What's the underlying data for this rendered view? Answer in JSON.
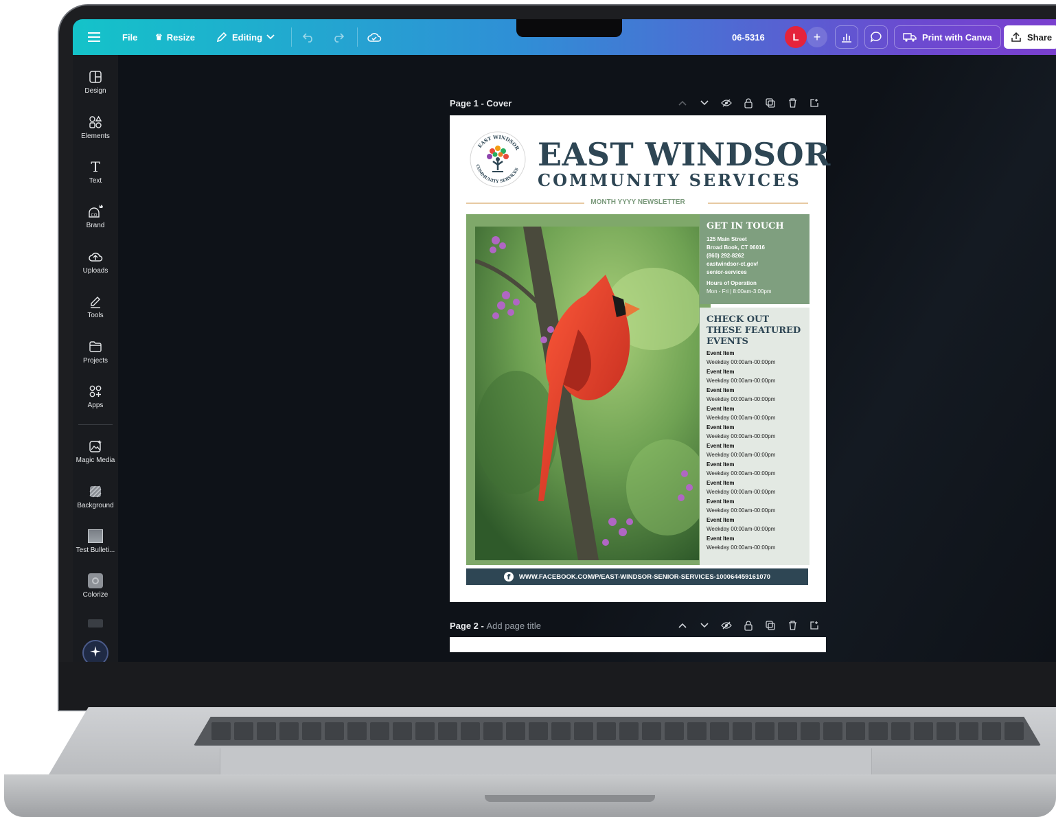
{
  "topbar": {
    "menu_icon": "hamburger-icon",
    "file_label": "File",
    "resize_label": "Resize",
    "editing_label": "Editing",
    "design_code": "06-5316",
    "avatar_initial": "L",
    "print_label": "Print with Canva",
    "share_label": "Share"
  },
  "sidebar": {
    "items": [
      {
        "label": "Design",
        "icon": "design-icon"
      },
      {
        "label": "Elements",
        "icon": "elements-icon"
      },
      {
        "label": "Text",
        "icon": "text-icon"
      },
      {
        "label": "Brand",
        "icon": "brand-icon"
      },
      {
        "label": "Uploads",
        "icon": "uploads-icon"
      },
      {
        "label": "Tools",
        "icon": "tools-icon"
      },
      {
        "label": "Projects",
        "icon": "projects-icon"
      },
      {
        "label": "Apps",
        "icon": "apps-icon"
      },
      {
        "label": "Magic Media",
        "icon": "magic-media-icon"
      },
      {
        "label": "Background",
        "icon": "background-icon"
      },
      {
        "label": "Test Bulleti...",
        "icon": "test-bulletin-thumbnail"
      },
      {
        "label": "Colorize",
        "icon": "colorize-icon"
      }
    ]
  },
  "pages": {
    "page1_prefix": "Page 1",
    "page1_title": "Cover",
    "page2_prefix": "Page 2",
    "page2_title_placeholder": "Add page title"
  },
  "newsletter": {
    "logo_top": "EAST WINDSOR",
    "logo_bottom": "COMMUNITY SERVICES",
    "title_line1": "EAST WINDSOR",
    "title_line2": "COMMUNITY SERVICES",
    "month_line": "MONTH YYYY NEWSLETTER",
    "contact": {
      "heading": "GET IN TOUCH",
      "address1": "125 Main Street",
      "address2": "Broad Book, CT 06016",
      "phone": "(860) 292-8262",
      "web1": "eastwindsor-ct.gov/",
      "web2": "senior-services",
      "hours_label": "Hours of Operation",
      "hours_value": "Mon - Fri | 8:00am-3:00pm"
    },
    "events": {
      "heading": "CHECK OUT THESE FEATURED EVENTS",
      "items": [
        {
          "name": "Event Item",
          "time": "Weekday 00:00am-00:00pm"
        },
        {
          "name": "Event Item",
          "time": "Weekday 00:00am-00:00pm"
        },
        {
          "name": "Event Item",
          "time": "Weekday 00:00am-00:00pm"
        },
        {
          "name": "Event Item",
          "time": "Weekday 00:00am-00:00pm"
        },
        {
          "name": "Event Item",
          "time": "Weekday 00:00am-00:00pm"
        },
        {
          "name": "Event Item",
          "time": "Weekday 00:00am-00:00pm"
        },
        {
          "name": "Event Item",
          "time": "Weekday 00:00am-00:00pm"
        },
        {
          "name": "Event Item",
          "time": "Weekday 00:00am-00:00pm"
        },
        {
          "name": "Event Item",
          "time": "Weekday 00:00am-00:00pm"
        },
        {
          "name": "Event Item",
          "time": "Weekday 00:00am-00:00pm"
        },
        {
          "name": "Event Item",
          "time": "Weekday 00:00am-00:00pm"
        }
      ]
    },
    "facebook_url": "WWW.FACEBOOK.COM/P/EAST-WINDSOR-SENIOR-SERVICES-100064459161070"
  },
  "colors": {
    "brand_teal": "#14c3c9",
    "brand_purple": "#7b3fcf",
    "navy": "#2e4654",
    "sage": "#7f9f7f",
    "avatar_red": "#e5233b"
  }
}
